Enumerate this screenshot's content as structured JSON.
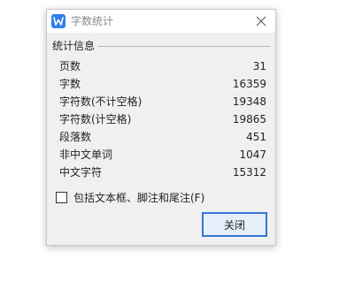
{
  "window": {
    "title": "字数统计",
    "app_icon": "wps-writer-icon",
    "close_icon": "close-icon"
  },
  "stats": {
    "group_title": "统计信息",
    "rows": [
      {
        "label": "页数",
        "value": "31"
      },
      {
        "label": "字数",
        "value": "16359"
      },
      {
        "label": "字符数(不计空格)",
        "value": "19348"
      },
      {
        "label": "字符数(计空格)",
        "value": "19865"
      },
      {
        "label": "段落数",
        "value": "451"
      },
      {
        "label": "非中文单词",
        "value": "1047"
      },
      {
        "label": "中文字符",
        "value": "15312"
      }
    ]
  },
  "options": {
    "include_textboxes_label": "包括文本框、脚注和尾注(F)",
    "include_textboxes_checked": false
  },
  "buttons": {
    "close_label": "关闭"
  },
  "colors": {
    "accent": "#3477d4",
    "icon_blue": "#2f7fec",
    "dialog_bg": "#f0f0f0"
  }
}
